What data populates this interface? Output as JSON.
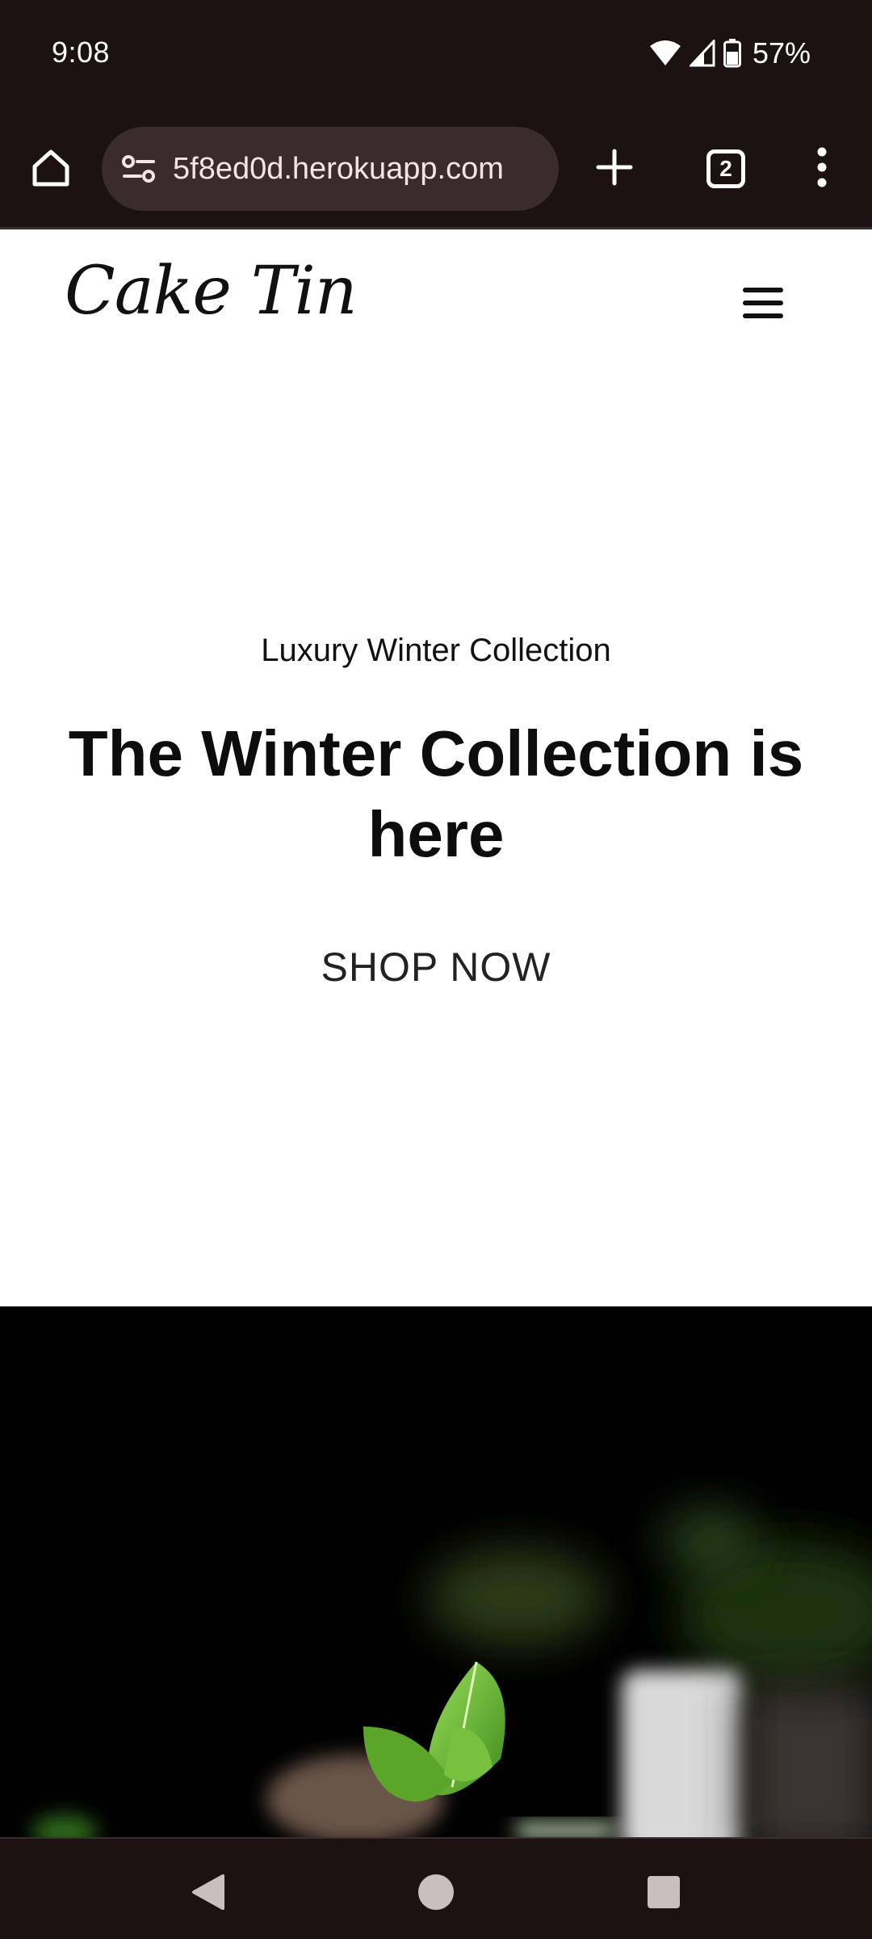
{
  "status_bar": {
    "time": "9:08",
    "battery": "57%",
    "icons": [
      "wifi-icon",
      "cell-signal-icon",
      "battery-icon"
    ]
  },
  "browser": {
    "url": "5f8ed0d.herokuapp.com",
    "tab_count": "2",
    "icons": [
      "home-icon",
      "site-settings-icon",
      "plus-icon",
      "more-vert-icon"
    ]
  },
  "site": {
    "logo": "Cake Tin",
    "menu_icon": "hamburger-icon"
  },
  "hero": {
    "subtitle": "Luxury Winter Collection",
    "title": "The Winter Collection is here",
    "cta": "SHOP NOW"
  },
  "navigation": {
    "icons": [
      "back-icon",
      "home-circle-icon",
      "recents-icon"
    ]
  },
  "colors": {
    "system_bar": "#1c1212",
    "url_bar": "#3a2c2b",
    "page_bg": "#ffffff",
    "text": "#0d0d0d",
    "hero_image_bg": "#010101"
  }
}
